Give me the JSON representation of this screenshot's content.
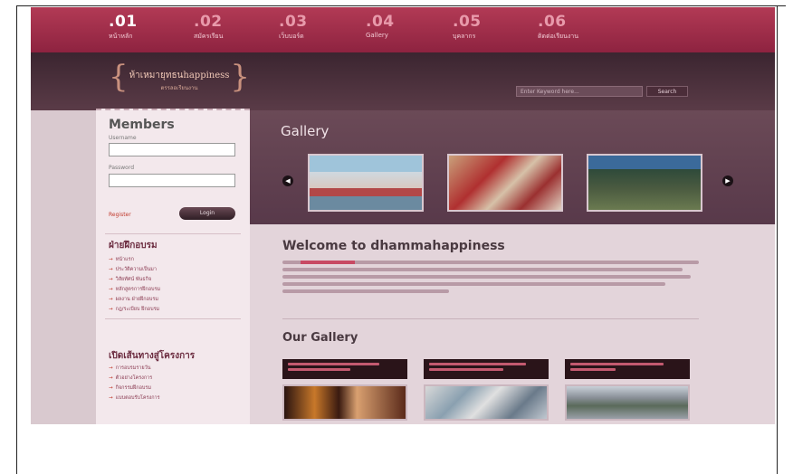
{
  "nav": {
    "items": [
      {
        "num": ".01",
        "label": "หน้าหลัก",
        "active": true
      },
      {
        "num": ".02",
        "label": "สมัครเรียน"
      },
      {
        "num": ".03",
        "label": "เว็บบอร์ด"
      },
      {
        "num": ".04",
        "label": "Gallery"
      },
      {
        "num": ".05",
        "label": "บุคลากร"
      },
      {
        "num": ".06",
        "label": "ติดต่อเรียนงาน"
      }
    ]
  },
  "header": {
    "logo_title": "ห้าเหมายุทธนhappiness",
    "logo_sub": "ตรรลอเรียนงาน",
    "search_placeholder": "Enter Keyword here...",
    "search_button": "Search"
  },
  "sidebar": {
    "members_title": "Members",
    "username_label": "Username",
    "password_label": "Password",
    "register_label": "Register",
    "login_button": "Login",
    "section1_title": "ฝ่ายฝึกอบรม",
    "section1_items": [
      "หน้าแรก",
      "ประวัติความเป็นมา",
      "วิสัยทัศน์ พันธกิจ",
      "หลักสูตรการฝึกอบรม",
      "ผลงาน ฝ่ายฝึกอบรม",
      "กฎ/ระเบียบ ฝึกอบรม"
    ],
    "section2_title": "เปิดเส้นทางสู่โครงการ",
    "section2_items": [
      "การอบรมรายวัน",
      "ตัวอย่างโครงการ",
      "กิจกรรมฝึกอบรม",
      "แบบตอบรับโครงการ"
    ]
  },
  "gallery": {
    "title": "Gallery",
    "prev_icon": "chevron-left-icon",
    "next_icon": "chevron-right-icon"
  },
  "main": {
    "welcome_title": "Welcome to dhammahappiness",
    "our_gallery_title": "Our Gallery"
  },
  "colors": {
    "nav_bg": "#9e2c48",
    "header_bg": "#4a303b",
    "accent": "#c84a64"
  }
}
